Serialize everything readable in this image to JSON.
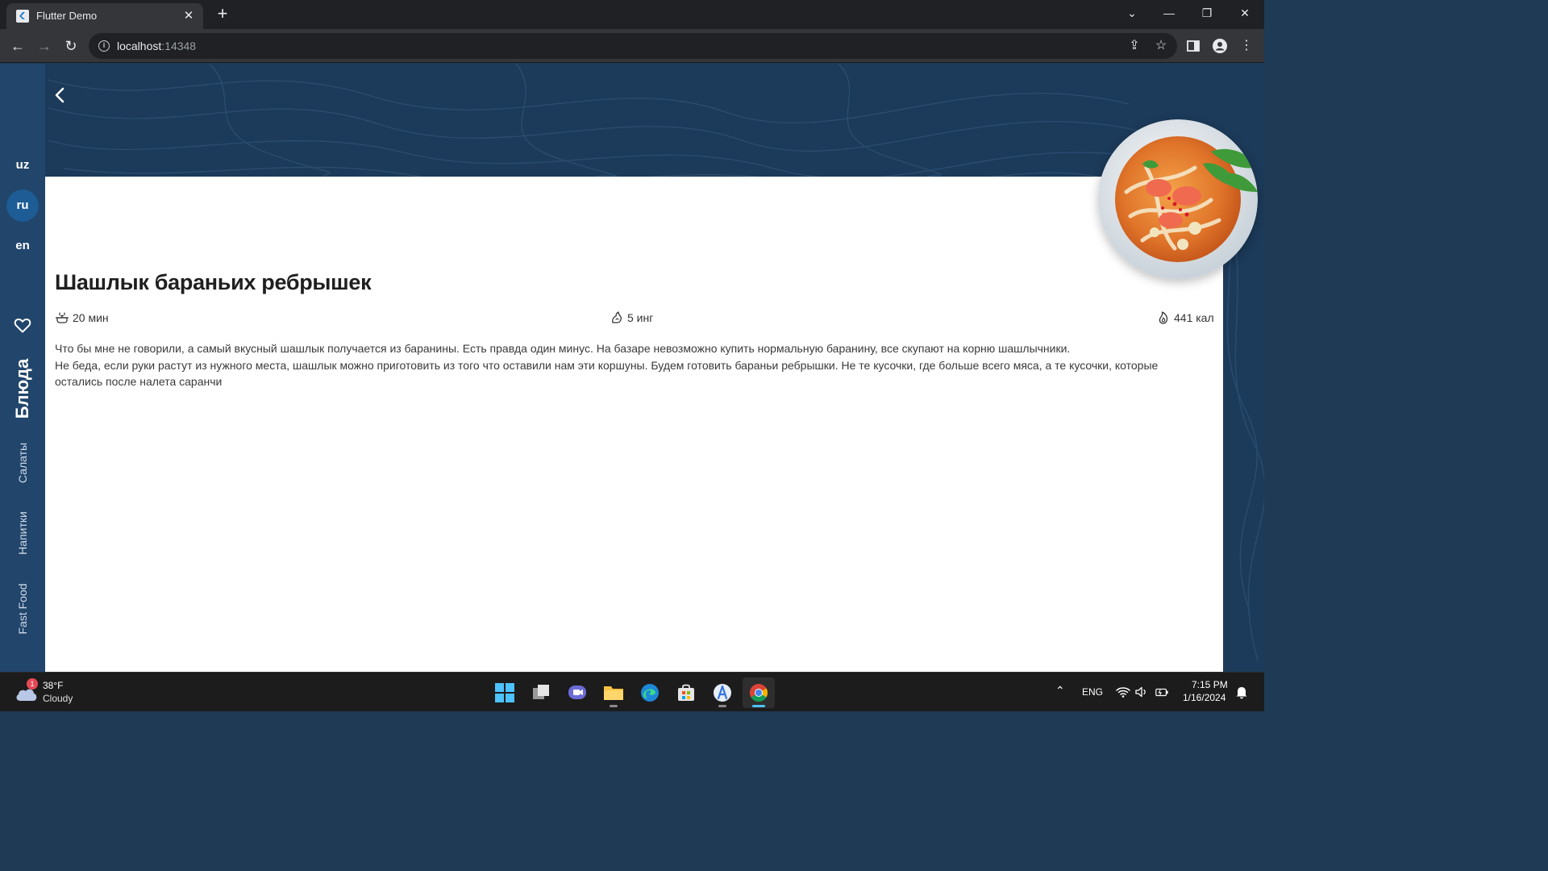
{
  "browser": {
    "tab_title": "Flutter Demo",
    "url_host": "localhost",
    "url_port": ":14348"
  },
  "sidebar": {
    "languages": [
      {
        "code": "uz",
        "active": false
      },
      {
        "code": "ru",
        "active": true
      },
      {
        "code": "en",
        "active": false
      }
    ],
    "categories": [
      {
        "label": "Блюда",
        "active": true
      },
      {
        "label": "Салаты",
        "active": false
      },
      {
        "label": "Напитки",
        "active": false
      },
      {
        "label": "Fast Food",
        "active": false
      }
    ]
  },
  "dish": {
    "title": "Шашлык бараньих ребрышек",
    "time": "20 мин",
    "ingredients": "5 инг",
    "calories": "441 кал",
    "description_line1": "Что бы мне не говорили, а самый вкусный шашлык получается из баранины. Есть правда один минус. На базаре невозможно купить нормальную баранину, все скупают на корню шашлычники.",
    "description_line2": "Не беда, если руки растут из нужного места, шашлык можно приготовить из того что оставили нам эти коршуны. Будем готовить бараньи ребрышки. Не те кусочки, где больше всего мяса, а те кусочки, которые остались после налета саранчи"
  },
  "taskbar": {
    "weather_temp": "38°F",
    "weather_condition": "Cloudy",
    "weather_badge": "1",
    "language": "ENG",
    "time": "7:15 PM",
    "date": "1/16/2024"
  },
  "colors": {
    "sidebar": "#21456b",
    "header_bg": "#1c3a59",
    "active_lang": "#1d5c94"
  }
}
